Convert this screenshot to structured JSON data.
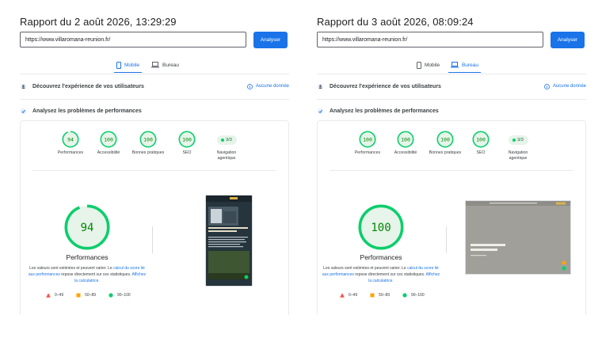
{
  "colors": {
    "accent": "#1a73e8",
    "pass": "#0cce6b",
    "pass_text": "#008800",
    "pass_fill": "#e6f4ea",
    "average": "#ffa400",
    "fail": "#ff4e42"
  },
  "reports": [
    {
      "title": "Rapport du 2 août 2026, 13:29:29",
      "url": "https://www.villaromana-reunion.fr/",
      "analyze_label": "Analyser",
      "tabs": [
        {
          "label": "Mobile",
          "icon": "smartphone-icon",
          "active": true
        },
        {
          "label": "Bureau",
          "icon": "laptop-icon",
          "active": false
        }
      ],
      "experience_label": "Découvrez l'expérience de vos utilisateurs",
      "no_data_label": "Aucune donnée",
      "diagnose_label": "Analysez les problèmes de performances",
      "scores": [
        {
          "label": "Performances",
          "value": "94",
          "fraction": 0.94
        },
        {
          "label": "Accessibilité",
          "value": "100",
          "fraction": 1.0
        },
        {
          "label": "Bonnes pratiques",
          "value": "100",
          "fraction": 1.0
        },
        {
          "label": "SEO",
          "value": "100",
          "fraction": 1.0
        }
      ],
      "agentic": {
        "value": "3/3",
        "label": "Navigation agentique"
      },
      "main_score": {
        "value": "94",
        "fraction": 0.94,
        "label": "Performances"
      },
      "desc_before": "Les valeurs sont estimées et peuvent varier. Le ",
      "desc_link1": "calcul du score lié aux performances",
      "desc_middle": " repose directement sur ces statistiques. ",
      "desc_link2": "Affichez la calculatrice.",
      "legend": [
        {
          "label": "0–49",
          "icon": "triangle-icon"
        },
        {
          "label": "50–89",
          "icon": "square-icon"
        },
        {
          "label": "90–100",
          "icon": "circle-icon"
        }
      ],
      "screenshot_view": "mobile"
    },
    {
      "title": "Rapport du 3 août 2026, 08:09:24",
      "url": "https://www.villaromana-reunion.fr/",
      "analyze_label": "Analyser",
      "tabs": [
        {
          "label": "Mobile",
          "icon": "smartphone-icon",
          "active": false
        },
        {
          "label": "Bureau",
          "icon": "laptop-icon",
          "active": true
        }
      ],
      "experience_label": "Découvrez l'expérience de vos utilisateurs",
      "no_data_label": "Aucune donnée",
      "diagnose_label": "Analysez les problèmes de performances",
      "scores": [
        {
          "label": "Performances",
          "value": "100",
          "fraction": 1.0
        },
        {
          "label": "Accessibilité",
          "value": "100",
          "fraction": 1.0
        },
        {
          "label": "Bonnes pratiques",
          "value": "100",
          "fraction": 1.0
        },
        {
          "label": "SEO",
          "value": "100",
          "fraction": 1.0
        }
      ],
      "agentic": {
        "value": "3/3",
        "label": "Navigation agentique"
      },
      "main_score": {
        "value": "100",
        "fraction": 1.0,
        "label": "Performances"
      },
      "desc_before": "Les valeurs sont estimées et peuvent varier. Le ",
      "desc_link1": "calcul du score lié aux performances",
      "desc_middle": " repose directement sur ces statistiques. ",
      "desc_link2": "Affichez la calculatrice.",
      "legend": [
        {
          "label": "0–49",
          "icon": "triangle-icon"
        },
        {
          "label": "50–89",
          "icon": "square-icon"
        },
        {
          "label": "90–100",
          "icon": "circle-icon"
        }
      ],
      "screenshot_view": "desktop"
    }
  ]
}
